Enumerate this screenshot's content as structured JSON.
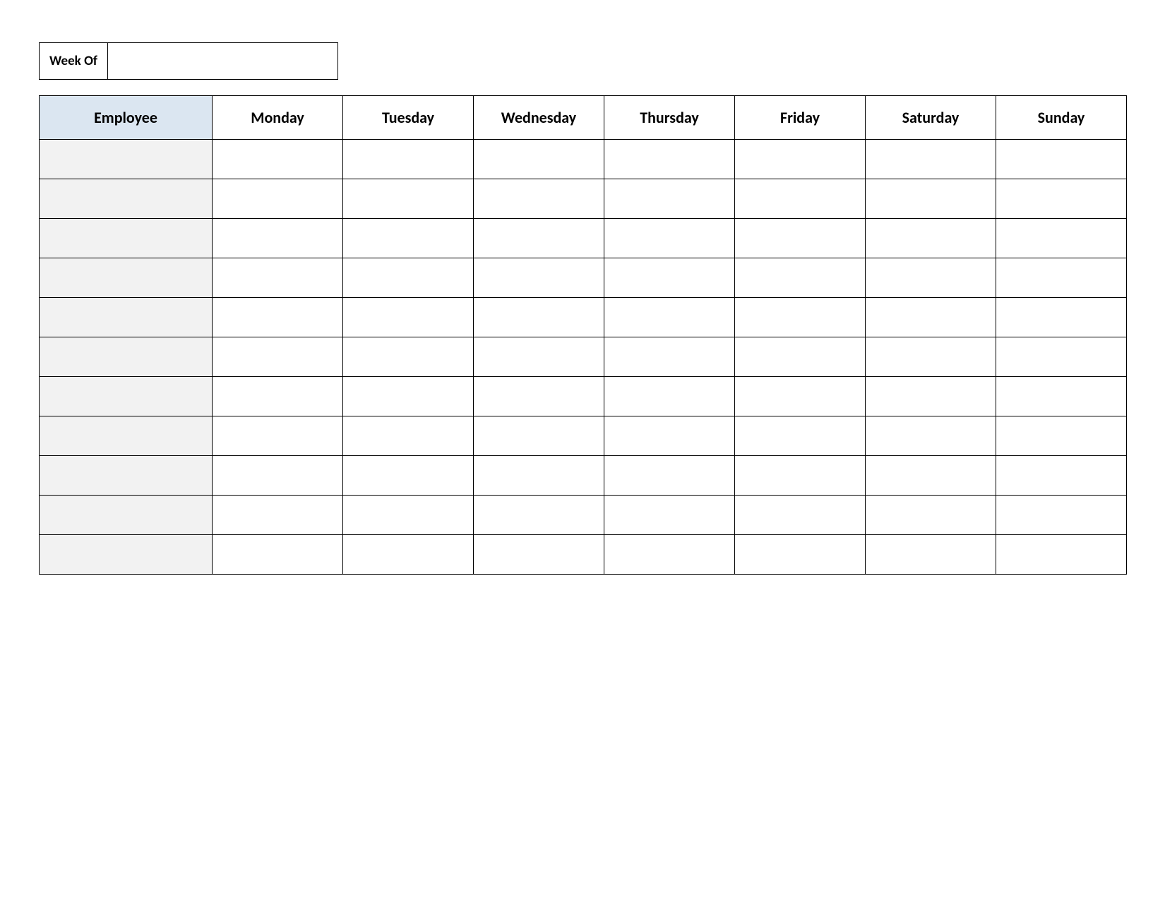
{
  "header": {
    "week_of_label": "Week Of",
    "week_of_value": ""
  },
  "table": {
    "columns": [
      "Employee",
      "Monday",
      "Tuesday",
      "Wednesday",
      "Thursday",
      "Friday",
      "Saturday",
      "Sunday"
    ],
    "rows": [
      {
        "employee": "",
        "mon": "",
        "tue": "",
        "wed": "",
        "thu": "",
        "fri": "",
        "sat": "",
        "sun": ""
      },
      {
        "employee": "",
        "mon": "",
        "tue": "",
        "wed": "",
        "thu": "",
        "fri": "",
        "sat": "",
        "sun": ""
      },
      {
        "employee": "",
        "mon": "",
        "tue": "",
        "wed": "",
        "thu": "",
        "fri": "",
        "sat": "",
        "sun": ""
      },
      {
        "employee": "",
        "mon": "",
        "tue": "",
        "wed": "",
        "thu": "",
        "fri": "",
        "sat": "",
        "sun": ""
      },
      {
        "employee": "",
        "mon": "",
        "tue": "",
        "wed": "",
        "thu": "",
        "fri": "",
        "sat": "",
        "sun": ""
      },
      {
        "employee": "",
        "mon": "",
        "tue": "",
        "wed": "",
        "thu": "",
        "fri": "",
        "sat": "",
        "sun": ""
      },
      {
        "employee": "",
        "mon": "",
        "tue": "",
        "wed": "",
        "thu": "",
        "fri": "",
        "sat": "",
        "sun": ""
      },
      {
        "employee": "",
        "mon": "",
        "tue": "",
        "wed": "",
        "thu": "",
        "fri": "",
        "sat": "",
        "sun": ""
      },
      {
        "employee": "",
        "mon": "",
        "tue": "",
        "wed": "",
        "thu": "",
        "fri": "",
        "sat": "",
        "sun": ""
      },
      {
        "employee": "",
        "mon": "",
        "tue": "",
        "wed": "",
        "thu": "",
        "fri": "",
        "sat": "",
        "sun": ""
      },
      {
        "employee": "",
        "mon": "",
        "tue": "",
        "wed": "",
        "thu": "",
        "fri": "",
        "sat": "",
        "sun": ""
      }
    ]
  }
}
